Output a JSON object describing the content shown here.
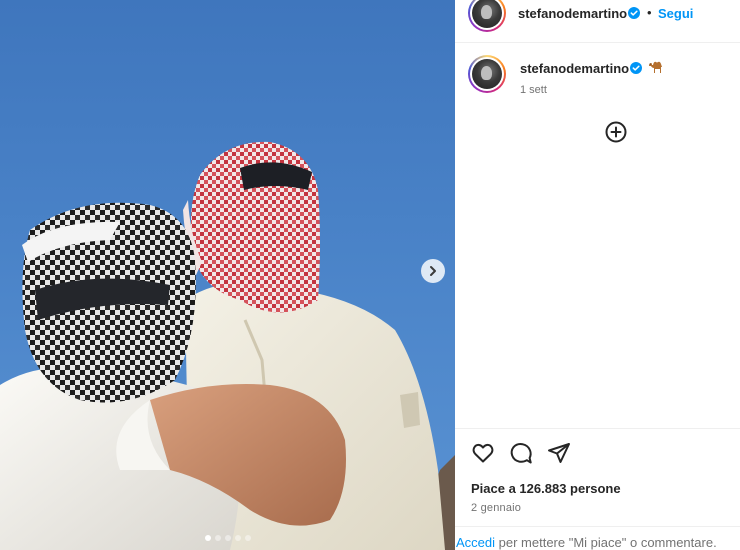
{
  "post": {
    "username": "stefanodemartino",
    "follow_label": "Segui",
    "separator": "•",
    "caption_emoji": "camel-emoji",
    "caption_time": "1 sett",
    "likes_text": "Piace a 126.883 persone",
    "date_text": "2 gennaio",
    "carousel": {
      "count": 5,
      "active_index": 0
    }
  },
  "login_prompt": {
    "link_label": "Accedi",
    "rest_text": " per mettere \"Mi piace\" o commentare."
  },
  "icons": {
    "verified": "verified-badge-icon",
    "next": "chevron-right-icon",
    "add_comment": "plus-circle-icon",
    "like": "heart-icon",
    "comment": "comment-bubble-icon",
    "share": "paper-plane-icon"
  },
  "colors": {
    "accent": "#0095f6",
    "text": "#262626",
    "muted": "#737373",
    "sky": "#4a83c8"
  }
}
